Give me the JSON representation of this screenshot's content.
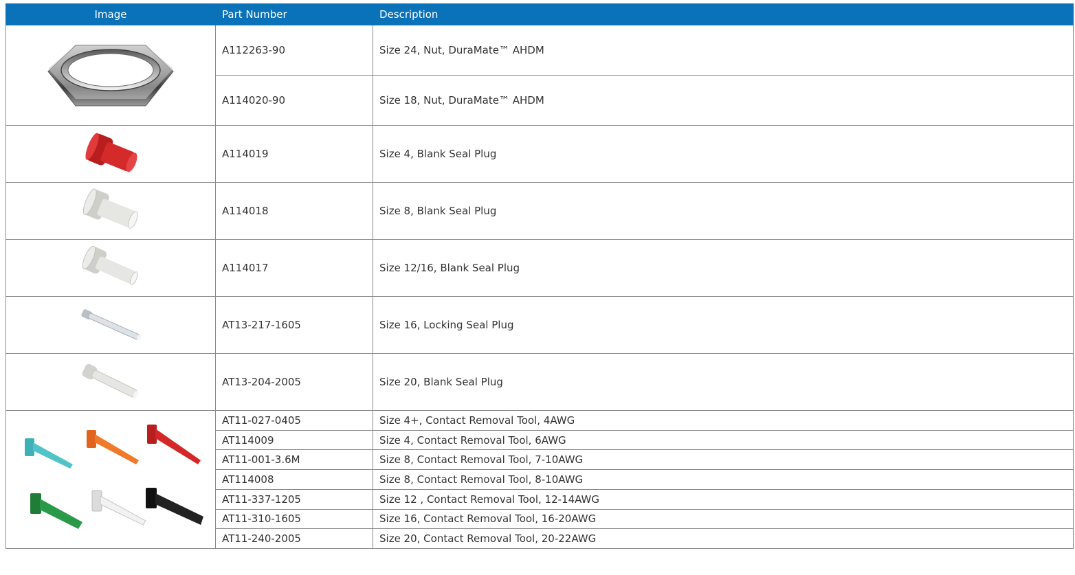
{
  "headers": {
    "image": "Image",
    "part_number": "Part Number",
    "description": "Description"
  },
  "rows": [
    {
      "part": "A112263-90",
      "desc": "Size 24, Nut, DuraMate™ AHDM"
    },
    {
      "part": "A114020-90",
      "desc": "Size 18, Nut, DuraMate™ AHDM"
    },
    {
      "part": "A114019",
      "desc": "Size 4, Blank Seal Plug"
    },
    {
      "part": "A114018",
      "desc": "Size 8, Blank Seal Plug"
    },
    {
      "part": "A114017",
      "desc": "Size 12/16, Blank Seal Plug"
    },
    {
      "part": "AT13-217-1605",
      "desc": "Size 16, Locking Seal Plug"
    },
    {
      "part": "AT13-204-2005",
      "desc": "Size 20, Blank Seal Plug"
    },
    {
      "part": "AT11-027-0405",
      "desc": "Size 4+, Contact Removal Tool, 4AWG"
    },
    {
      "part": "AT114009",
      "desc": "Size 4, Contact Removal Tool, 6AWG"
    },
    {
      "part": "AT11-001-3.6M",
      "desc": "Size 8, Contact Removal Tool, 7-10AWG"
    },
    {
      "part": "AT114008",
      "desc": "Size 8, Contact Removal Tool, 8-10AWG"
    },
    {
      "part": "AT11-337-1205",
      "desc": "Size 12 , Contact Removal Tool, 12-14AWG"
    },
    {
      "part": "AT11-310-1605",
      "desc": "Size 16, Contact Removal Tool, 16-20AWG"
    },
    {
      "part": "AT11-240-2005",
      "desc": "Size 20, Contact Removal Tool, 20-22AWG"
    }
  ],
  "images": [
    {
      "icon": "hex-nut-image",
      "color": "#8a8a8a"
    },
    {
      "icon": "red-seal-plug-image",
      "color": "#d42a2a"
    },
    {
      "icon": "white-seal-plug-image",
      "color": "#e6e6e2"
    },
    {
      "icon": "white-seal-plug-image",
      "color": "#e6e6e2"
    },
    {
      "icon": "locking-seal-plug-image",
      "color": "#dde2e6"
    },
    {
      "icon": "white-seal-plug-image",
      "color": "#e6e6e2"
    },
    {
      "icon": "removal-tools-image",
      "colors": [
        "#4fc3c8",
        "#f07a2a",
        "#d42828",
        "#2a9a48",
        "#f2f2f2",
        "#222222"
      ]
    }
  ],
  "accent_color": "#0a72b9"
}
